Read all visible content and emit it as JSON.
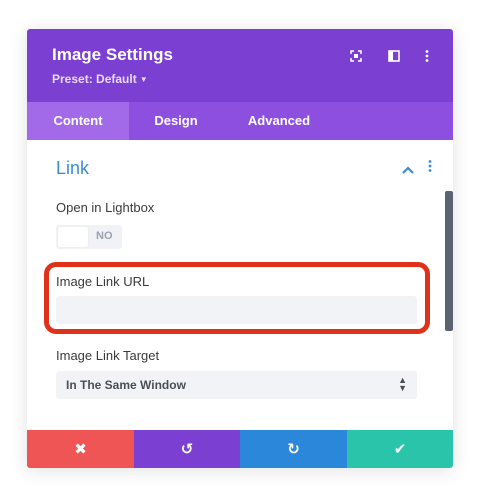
{
  "header": {
    "title": "Image Settings",
    "preset": "Preset: Default",
    "icons": [
      "focus-icon",
      "sidebar-toggle-icon",
      "more-vertical-icon"
    ]
  },
  "tabs": [
    {
      "label": "Content",
      "active": true
    },
    {
      "label": "Design",
      "active": false
    },
    {
      "label": "Advanced",
      "active": false
    }
  ],
  "section": {
    "title": "Link",
    "collapse_glyph": "^",
    "menu_glyph": "⋮"
  },
  "fields": {
    "lightbox": {
      "label": "Open in Lightbox",
      "toggle_text": "NO"
    },
    "url": {
      "label": "Image Link URL",
      "value": ""
    },
    "target": {
      "label": "Image Link Target",
      "value": "In The Same Window"
    }
  },
  "footer": {
    "cancel_glyph": "✖",
    "undo_glyph": "↺",
    "redo_glyph": "↻",
    "save_glyph": "✔",
    "colors": {
      "cancel": "#ef5555",
      "undo": "#7b3fd1",
      "redo": "#2b87da",
      "save": "#29c4a9"
    }
  },
  "colors": {
    "header": "#7b3fd1",
    "tabs": "#8d4fdf",
    "accent": "#3b8dd3",
    "highlight": "#e0311a"
  }
}
